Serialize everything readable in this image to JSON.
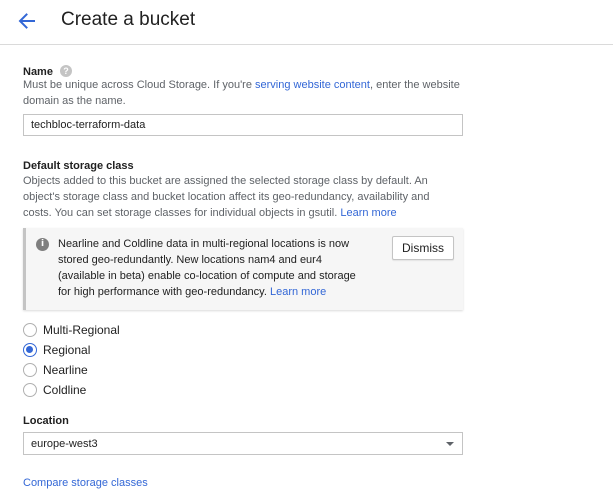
{
  "header": {
    "title": "Create a bucket",
    "back_icon": "arrow-back-icon",
    "accent_color": "#3367d6"
  },
  "name_section": {
    "label": "Name",
    "help_icon": "help-icon",
    "help_glyph": "?",
    "desc_line1_before": "Must be unique across Cloud Storage. If you're ",
    "desc_link": "serving website content",
    "desc_line1_after": ", enter the website",
    "desc_line2": "domain as the name.",
    "input_value": "techbloc-terraform-data"
  },
  "storage_class_section": {
    "label": "Default storage class",
    "desc_line1": "Objects added to this bucket are assigned the selected storage class by default. An",
    "desc_line2": "object's storage class and bucket location affect its geo-redundancy, availability and",
    "desc_line3_before": "costs. You can set storage classes for individual objects in gsutil. ",
    "desc_link": "Learn more"
  },
  "notice": {
    "icon": "info-icon",
    "icon_glyph": "i",
    "line1": "Nearline and Coldline data in multi-regional locations is now",
    "line2": "stored geo-redundantly. New locations nam4 and eur4",
    "line3": "(available in beta) enable co-location of compute and storage",
    "line4_before": "for high performance with geo-redundancy. ",
    "line4_link": "Learn more",
    "dismiss_label": "Dismiss"
  },
  "storage_classes": [
    {
      "label": "Multi-Regional",
      "checked": false
    },
    {
      "label": "Regional",
      "checked": true
    },
    {
      "label": "Nearline",
      "checked": false
    },
    {
      "label": "Coldline",
      "checked": false
    }
  ],
  "location_section": {
    "label": "Location",
    "selected": "europe-west3",
    "dropdown_icon": "dropdown-arrow-icon"
  },
  "footer": {
    "compare_link": "Compare storage classes"
  }
}
